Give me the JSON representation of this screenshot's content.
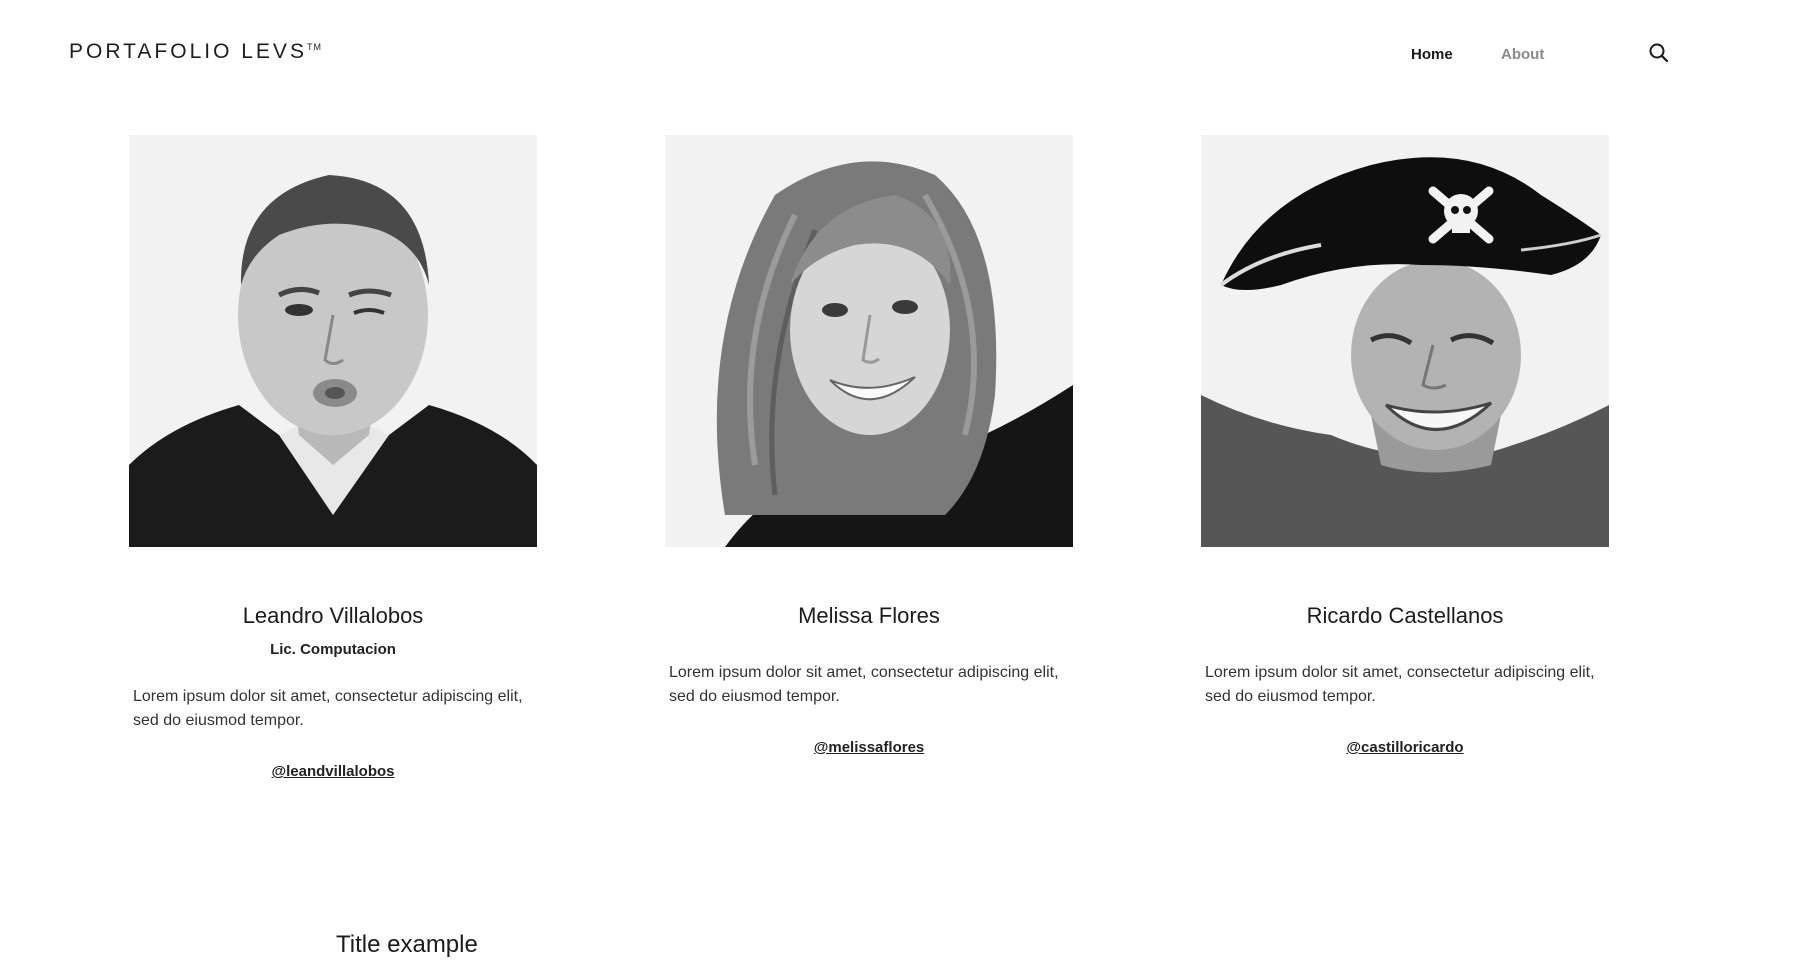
{
  "header": {
    "brand": "PORTAFOLIO LEVS",
    "brand_mark": "TM",
    "nav": [
      {
        "label": "Home",
        "active": true
      },
      {
        "label": "About",
        "active": false
      }
    ],
    "search_icon": "search-icon"
  },
  "team": [
    {
      "name": "Leandro Villalobos",
      "role": "Lic. Computacion",
      "description": "Lorem ipsum dolor sit amet, consectetur adipiscing elit, sed do eiusmod tempor.",
      "handle": "@leandvillalobos"
    },
    {
      "name": "Melissa Flores",
      "description": "Lorem ipsum dolor sit amet, consectetur adipiscing elit, sed do eiusmod tempor.",
      "handle": "@melissaflores"
    },
    {
      "name": "Ricardo Castellanos",
      "description": "Lorem ipsum dolor sit amet, consectetur adipiscing elit, sed do eiusmod tempor.",
      "handle": "@castilloricardo"
    }
  ],
  "section": {
    "title": "Title example"
  },
  "colors": {
    "text": "#1a1a1a",
    "nav_inactive": "#8a8a8a",
    "photo_bg": "#f2f2f2"
  }
}
